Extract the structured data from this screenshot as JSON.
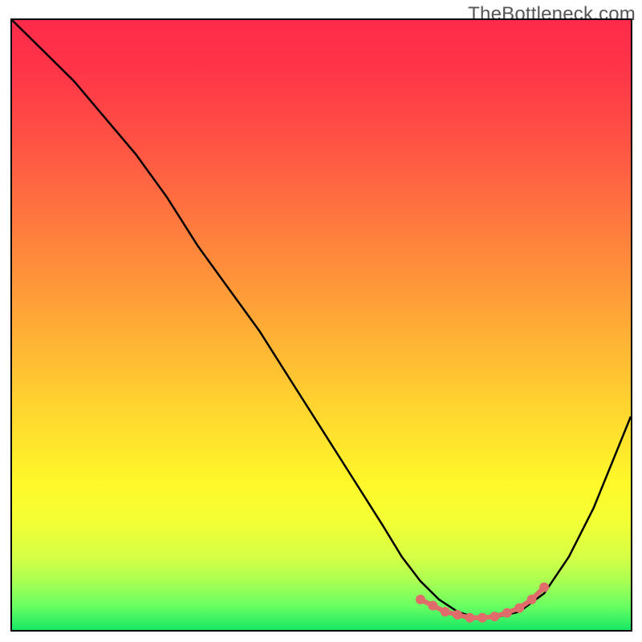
{
  "watermark": "TheBottleneck.com",
  "chart_data": {
    "type": "line",
    "title": "",
    "xlabel": "",
    "ylabel": "",
    "xlim": [
      0,
      100
    ],
    "ylim": [
      0,
      100
    ],
    "note": "Axes are unlabeled; values are relative estimates read from pixel curve positions. x=0..100 left→right, y=0=bottom 100=top.",
    "series": [
      {
        "name": "curve",
        "x": [
          0,
          5,
          10,
          15,
          20,
          25,
          30,
          35,
          40,
          45,
          50,
          55,
          60,
          63,
          66,
          69,
          72,
          75,
          78,
          82,
          86,
          90,
          94,
          98,
          100
        ],
        "y": [
          100,
          95,
          90,
          84,
          78,
          71,
          63,
          56,
          49,
          41,
          33,
          25,
          17,
          12,
          8,
          5,
          3,
          2,
          2,
          3,
          6,
          12,
          20,
          30,
          35
        ]
      },
      {
        "name": "highlight-region",
        "x": [
          66,
          68,
          70,
          72,
          74,
          76,
          78,
          80,
          82,
          84,
          86
        ],
        "y": [
          5,
          4,
          3,
          2.5,
          2,
          2,
          2.2,
          2.8,
          3.6,
          5,
          7
        ]
      }
    ],
    "colors": {
      "curve": "#000000",
      "highlight": "#e06b6b"
    },
    "background": "rainbow-vertical-gradient"
  }
}
